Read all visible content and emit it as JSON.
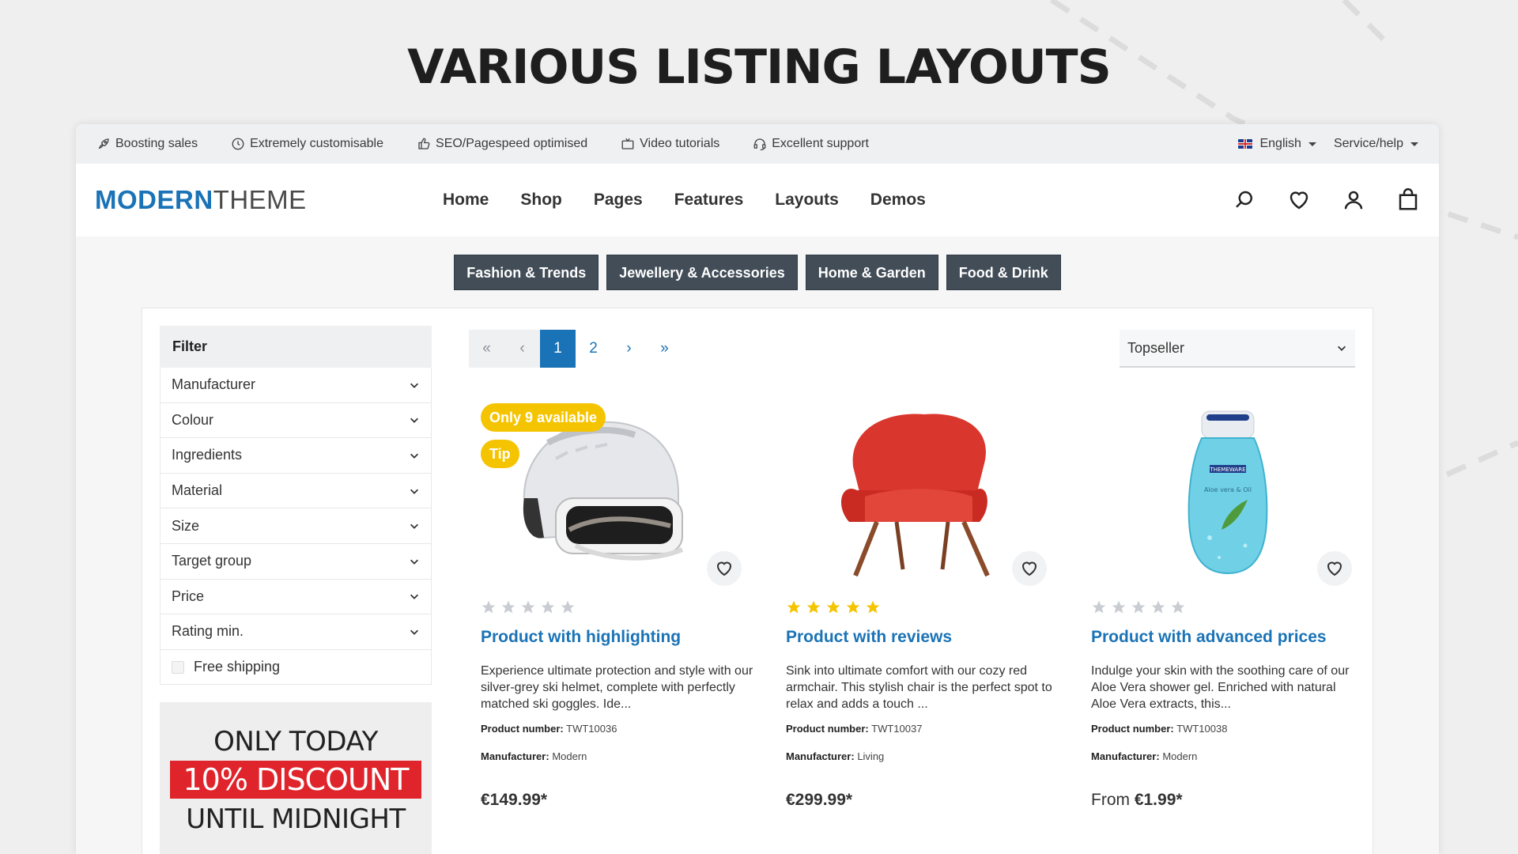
{
  "headline": "VARIOUS LISTING LAYOUTS",
  "topbar": {
    "usps": [
      {
        "icon": "rocket-icon",
        "label": "Boosting sales"
      },
      {
        "icon": "clock-icon",
        "label": "Extremely customisable"
      },
      {
        "icon": "thumbs-up-icon",
        "label": "SEO/Pagespeed optimised"
      },
      {
        "icon": "tv-icon",
        "label": "Video tutorials"
      },
      {
        "icon": "headset-icon",
        "label": "Excellent support"
      }
    ],
    "language": "English",
    "service": "Service/help"
  },
  "header": {
    "logo_bold": "MODERN",
    "logo_light": "THEME",
    "nav": [
      "Home",
      "Shop",
      "Pages",
      "Features",
      "Layouts",
      "Demos"
    ]
  },
  "categories": [
    "Fashion & Trends",
    "Jewellery & Accessories",
    "Home & Garden",
    "Food & Drink"
  ],
  "filter": {
    "title": "Filter",
    "items": [
      "Manufacturer",
      "Colour",
      "Ingredients",
      "Material",
      "Size",
      "Target group",
      "Price",
      "Rating min."
    ],
    "checkbox_label": "Free shipping"
  },
  "promo": {
    "line1": "ONLY TODAY",
    "line2": "10% DISCOUNT",
    "line3": "UNTIL MIDNIGHT"
  },
  "pagination": {
    "first": "«",
    "prev": "‹",
    "pages": [
      "1",
      "2"
    ],
    "active": "1",
    "next": "›",
    "last": "»"
  },
  "sort": {
    "selected": "Topseller"
  },
  "products": [
    {
      "badges": [
        "Only 9 available",
        "Tip"
      ],
      "stars_filled": 0,
      "name": "Product with highlighting",
      "description": "Experience ultimate protection and style with our silver-grey ski helmet, complete with perfectly matched ski goggles. Ide...",
      "product_number_label": "Product number:",
      "product_number": "TWT10036",
      "manufacturer_label": "Manufacturer:",
      "manufacturer": "Modern",
      "price_prefix": "",
      "price": "€149.99*"
    },
    {
      "badges": [],
      "stars_filled": 5,
      "name": "Product with reviews",
      "description": "Sink into ultimate comfort with our cozy red armchair. This stylish chair is the perfect spot to relax and adds a touch ...",
      "product_number_label": "Product number:",
      "product_number": "TWT10037",
      "manufacturer_label": "Manufacturer:",
      "manufacturer": "Living",
      "price_prefix": "",
      "price": "€299.99*"
    },
    {
      "badges": [],
      "stars_filled": 0,
      "name": "Product with advanced prices",
      "description": "Indulge your skin with the soothing care of our Aloe Vera shower gel. Enriched with natural Aloe Vera extracts, this...",
      "product_number_label": "Product number:",
      "product_number": "TWT10038",
      "manufacturer_label": "Manufacturer:",
      "manufacturer": "Modern",
      "price_prefix": "From ",
      "price": "€1.99*",
      "bottle_label_brand": "THEMEWARE",
      "bottle_label_product": "Aloe vera & Oil"
    }
  ],
  "colors": {
    "accent": "#1a73b6",
    "chip": "#424d58",
    "badge": "#f5c400",
    "star_filled": "#f5c400",
    "star_empty": "#c9ccd1",
    "promo_red": "#e0242b"
  }
}
